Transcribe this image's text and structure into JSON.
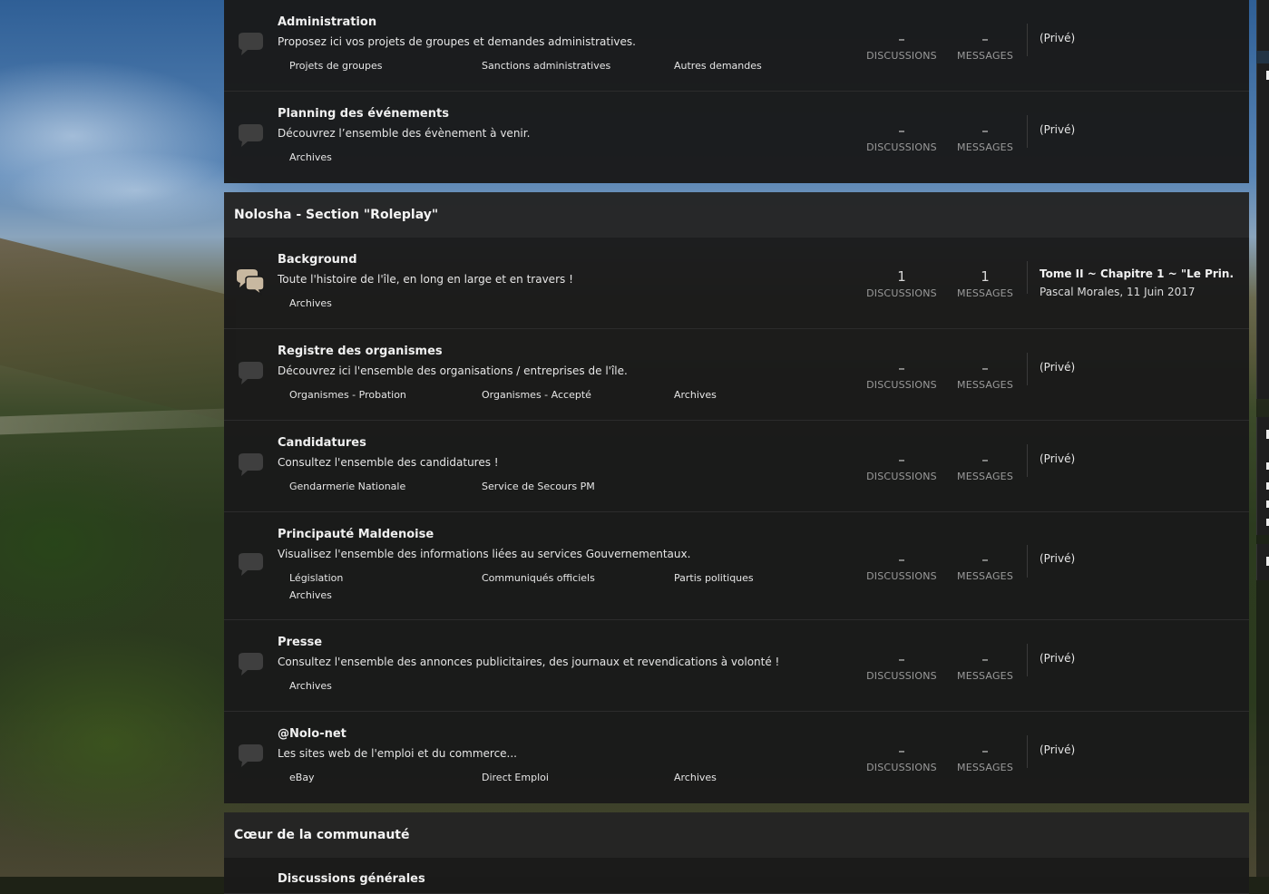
{
  "colors": {
    "panel": "#1a1a1a",
    "category_header": "#242424",
    "text": "#e6e6e6",
    "muted": "#9a9a9a",
    "icon_unread": "#c8b8a0",
    "icon_read": "#3f3f3f"
  },
  "section_top": {
    "nodes": [
      {
        "title": "Administration",
        "description": "Proposez ici vos projets de groupes et demandes administratives.",
        "subforums": [
          "Projets de groupes",
          "Sanctions administratives",
          "Autres demandes"
        ],
        "discussions": "–",
        "messages": "–",
        "last_post": "(Privé)"
      },
      {
        "title": "Planning des événements",
        "description": "Découvrez l’ensemble des évènement à venir.",
        "subforums": [
          "Archives"
        ],
        "discussions": "–",
        "messages": "–",
        "last_post": "(Privé)"
      }
    ]
  },
  "section_roleplay": {
    "title": "Nolosha - Section \"Roleplay\"",
    "nodes": [
      {
        "title": "Background",
        "description": "Toute l'histoire de l'île, en long en large et en travers !",
        "subforums": [
          "Archives"
        ],
        "discussions": "1",
        "messages": "1",
        "last_post_title": "Tome II ~ Chapitre 1 ~ \"Le Prin...",
        "last_post_meta": "Pascal Morales, 11 Juin 2017",
        "icon": "chat-bubbles-icon"
      },
      {
        "title": "Registre des organismes",
        "description": "Découvrez ici l'ensemble des organisations / entreprises de l'île.",
        "subforums": [
          "Organismes - Probation",
          "Organismes - Accepté",
          "Archives"
        ],
        "discussions": "–",
        "messages": "–",
        "last_post": "(Privé)"
      },
      {
        "title": "Candidatures",
        "description": "Consultez l'ensemble des candidatures !",
        "subforums": [
          "Gendarmerie Nationale",
          "Service de Secours PM"
        ],
        "discussions": "–",
        "messages": "–",
        "last_post": "(Privé)"
      },
      {
        "title": "Principauté Maldenoise",
        "description": "Visualisez l'ensemble des informations liées au services Gouvernementaux.",
        "subforums": [
          "Législation",
          "Communiqués officiels",
          "Partis politiques",
          "Archives"
        ],
        "discussions": "–",
        "messages": "–",
        "last_post": "(Privé)"
      },
      {
        "title": "Presse",
        "description": "Consultez l'ensemble des annonces publicitaires, des journaux et revendications à volonté !",
        "subforums": [
          "Archives"
        ],
        "discussions": "–",
        "messages": "–",
        "last_post": "(Privé)"
      },
      {
        "title": "@Nolo-net",
        "description": "Les sites web de l'emploi et du commerce...",
        "subforums": [
          "eBay",
          "Direct Emploi",
          "Archives"
        ],
        "discussions": "–",
        "messages": "–",
        "last_post": "(Privé)"
      }
    ]
  },
  "section_community": {
    "title": "Cœur de la communauté",
    "nodes": [
      {
        "title": "Discussions générales"
      }
    ]
  },
  "labels": {
    "discussions": "DISCUSSIONS",
    "messages": "MESSAGES"
  }
}
